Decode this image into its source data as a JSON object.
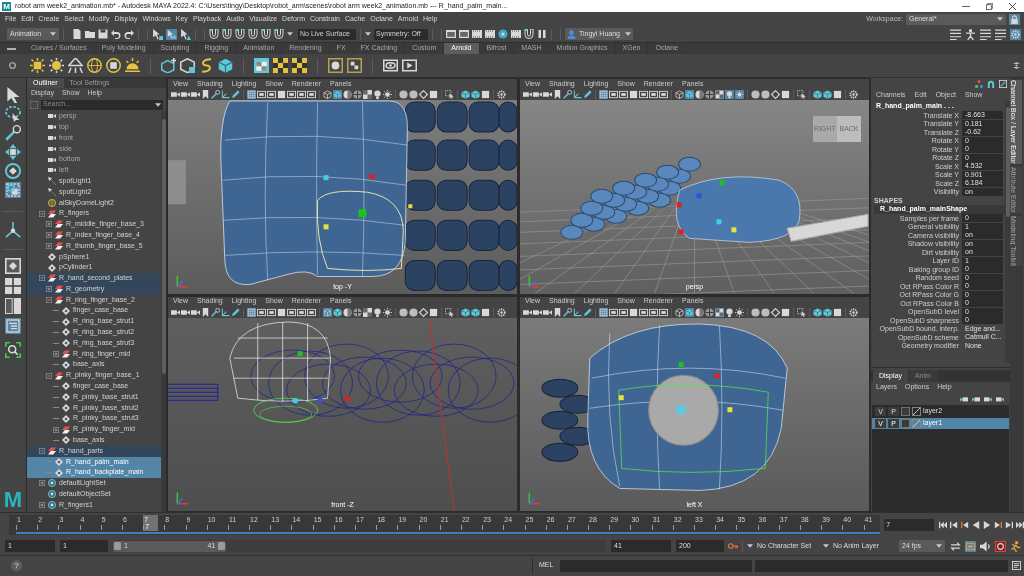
{
  "window": {
    "logo": "M",
    "title": "robot arm week2_animation.mb* - Autodesk MAYA 2022.4: C:\\Users\\tingy\\Desktop\\robot_arm\\scenes\\robot arm week2_animation.mb --- R_hand_palm_main..."
  },
  "menu_bar": [
    "File",
    "Edit",
    "Create",
    "Select",
    "Modify",
    "Display",
    "Windows",
    "Key",
    "Playback",
    "Audio",
    "Visualize",
    "Deform",
    "Constrain",
    "Cache",
    "Octane",
    "Arnold",
    "Help"
  ],
  "workspace": {
    "label": "Workspace:",
    "value": "General*",
    "locked": true
  },
  "status_line": {
    "menu_set": "Animation",
    "select_modes": [
      {
        "selected": false
      },
      {
        "selected": true
      },
      {
        "selected": false
      }
    ],
    "live_surface": "No Live Surface",
    "symmetry": "Symmetry: Off",
    "user": "Tingyi Huang",
    "panel_toggles": [
      {
        "on": false
      },
      {
        "on": false
      },
      {
        "on": false
      },
      {
        "on": false
      },
      {
        "on": true
      }
    ]
  },
  "shelf_tabs": [
    {
      "label": "Curves / Surfaces",
      "selected": false
    },
    {
      "label": "Poly Modeling",
      "selected": false
    },
    {
      "label": "Sculpting",
      "selected": false
    },
    {
      "label": "Rigging",
      "selected": false
    },
    {
      "label": "Animation",
      "selected": false
    },
    {
      "label": "Rendering",
      "selected": false
    },
    {
      "label": "FX",
      "selected": false
    },
    {
      "label": "FX Caching",
      "selected": false
    },
    {
      "label": "Custom",
      "selected": false
    },
    {
      "label": "Arnold",
      "selected": true
    },
    {
      "label": "Bifrost",
      "selected": false
    },
    {
      "label": "MASH",
      "selected": false
    },
    {
      "label": "Motion Graphics",
      "selected": false
    },
    {
      "label": "XGen",
      "selected": false
    },
    {
      "label": "Octane",
      "selected": false
    }
  ],
  "toolbox": {
    "tools": [
      {
        "selected": false
      },
      {
        "selected": false
      },
      {
        "selected": false
      },
      {
        "selected": false
      },
      {
        "selected": false
      },
      {
        "selected": true
      },
      {
        "selected": false
      }
    ],
    "layouts": [
      {
        "selected": false
      },
      {
        "selected": false
      },
      {
        "selected": false
      },
      {
        "selected": true
      }
    ],
    "logo": "M"
  },
  "outliner": {
    "tabs": [
      {
        "label": "Outliner",
        "selected": true
      },
      {
        "label": "Tool Settings",
        "selected": false
      }
    ],
    "menus": [
      "Display",
      "Show",
      "Help"
    ],
    "search": {
      "placeholder": "Search..."
    },
    "items": [
      {
        "label": "persp",
        "kind": "camera",
        "selected": false,
        "highlighted": false,
        "hidden": true
      },
      {
        "label": "top",
        "kind": "camera",
        "selected": false,
        "highlighted": false,
        "hidden": true
      },
      {
        "label": "front",
        "kind": "camera",
        "selected": false,
        "highlighted": false,
        "hidden": true
      },
      {
        "label": "side",
        "kind": "camera",
        "selected": false,
        "highlighted": false,
        "hidden": true
      },
      {
        "label": "bottom",
        "kind": "camera",
        "selected": false,
        "highlighted": false,
        "hidden": true
      },
      {
        "label": "left",
        "kind": "camera",
        "selected": false,
        "highlighted": false,
        "hidden": true
      },
      {
        "label": "spotLight1",
        "kind": "spotlight",
        "selected": false,
        "highlighted": false,
        "hidden": false
      },
      {
        "label": "spotLight2",
        "kind": "spotlight",
        "selected": false,
        "highlighted": false,
        "hidden": false
      },
      {
        "label": "aiSkyDomeLight2",
        "kind": "skydome",
        "selected": false,
        "highlighted": false,
        "hidden": false
      },
      {
        "label": "R_fingers",
        "kind": "group",
        "expanded": true,
        "selected": false,
        "highlighted": false,
        "hidden": false,
        "children": [
          {
            "label": "R_middle_finger_base_3",
            "kind": "group",
            "expanded": false,
            "selected": false,
            "highlighted": false,
            "hidden": false
          },
          {
            "label": "R_index_finger_base_4",
            "kind": "group",
            "expanded": false,
            "selected": false,
            "highlighted": false,
            "hidden": false
          },
          {
            "label": "R_thumb_finger_base_5",
            "kind": "group",
            "expanded": false,
            "selected": false,
            "highlighted": false,
            "hidden": false
          }
        ]
      },
      {
        "label": "pSphere1",
        "kind": "transform",
        "selected": false,
        "highlighted": false,
        "hidden": false
      },
      {
        "label": "pCylinder1",
        "kind": "transform",
        "selected": false,
        "highlighted": false,
        "hidden": false
      },
      {
        "label": "R_hand_second_plates",
        "kind": "group",
        "expanded": true,
        "selected": false,
        "highlighted": true,
        "hidden": false,
        "children": [
          {
            "label": "R_geometry",
            "kind": "group",
            "expanded": false,
            "selected": false,
            "highlighted": true,
            "hidden": false
          },
          {
            "label": "R_ring_finger_base_2",
            "kind": "group",
            "expanded": true,
            "selected": false,
            "highlighted": false,
            "hidden": false,
            "children": [
              {
                "label": "finger_case_base",
                "kind": "transform",
                "selected": false,
                "highlighted": false,
                "hidden": false
              },
              {
                "label": "R_ring_base_strut1",
                "kind": "transform",
                "selected": false,
                "highlighted": false,
                "hidden": false
              },
              {
                "label": "R_ring_base_strut2",
                "kind": "transform",
                "selected": false,
                "highlighted": false,
                "hidden": false
              },
              {
                "label": "R_ring_base_strut3",
                "kind": "transform",
                "selected": false,
                "highlighted": false,
                "hidden": false
              },
              {
                "label": "R_ring_finger_mid",
                "kind": "group",
                "expanded": false,
                "selected": false,
                "highlighted": false,
                "hidden": false
              },
              {
                "label": "base_axis",
                "kind": "transform",
                "selected": false,
                "highlighted": false,
                "hidden": false
              }
            ]
          },
          {
            "label": "R_pinky_finger_base_1",
            "kind": "group",
            "expanded": true,
            "selected": false,
            "highlighted": false,
            "hidden": false,
            "children": [
              {
                "label": "finger_case_base",
                "kind": "transform",
                "selected": false,
                "highlighted": false,
                "hidden": false
              },
              {
                "label": "R_pinky_base_strut1",
                "kind": "transform",
                "selected": false,
                "highlighted": false,
                "hidden": false
              },
              {
                "label": "R_pinky_base_strut2",
                "kind": "transform",
                "selected": false,
                "highlighted": false,
                "hidden": false
              },
              {
                "label": "R_pinky_base_strut3",
                "kind": "transform",
                "selected": false,
                "highlighted": false,
                "hidden": false
              },
              {
                "label": "R_pinky_finger_mid",
                "kind": "group",
                "expanded": false,
                "selected": false,
                "highlighted": false,
                "hidden": false
              },
              {
                "label": "base_axis",
                "kind": "transform",
                "selected": false,
                "highlighted": false,
                "hidden": false
              }
            ]
          }
        ]
      },
      {
        "label": "R_hand_parts",
        "kind": "group",
        "expanded": true,
        "selected": false,
        "highlighted": true,
        "hidden": false,
        "children": [
          {
            "label": "R_hand_palm_main",
            "kind": "transform",
            "selected": true,
            "highlighted": false,
            "hidden": false
          },
          {
            "label": "R_hand_backplate_main",
            "kind": "transform",
            "selected": true,
            "highlighted": false,
            "hidden": false
          }
        ]
      },
      {
        "label": "defaultLightSet",
        "kind": "set",
        "expanded": false,
        "selected": false,
        "highlighted": false,
        "hidden": false
      },
      {
        "label": "defaultObjectSet",
        "kind": "set",
        "selected": false,
        "highlighted": false,
        "hidden": false
      },
      {
        "label": "R_fingers1",
        "kind": "set",
        "expanded": false,
        "selected": false,
        "highlighted": false,
        "hidden": false
      }
    ]
  },
  "viewports": [
    {
      "menus": [
        "View",
        "Shading",
        "Lighting",
        "Show",
        "Renderer",
        "Panels"
      ],
      "toolbar": [
        {
          "on": false
        },
        {
          "on": false
        },
        {
          "on": false
        },
        {
          "on": false
        },
        {
          "on": false
        },
        {
          "on": false
        },
        {
          "on": false
        },
        {
          "on": true
        },
        {
          "on": false
        },
        {
          "on": false
        },
        {
          "on": false
        },
        {
          "on": false
        },
        {
          "on": false
        },
        {
          "on": false
        },
        {
          "on": false
        },
        {
          "on": true
        },
        {
          "on": false
        },
        {
          "on": false
        },
        {
          "on": false
        },
        {
          "on": false
        },
        {
          "on": false
        },
        {
          "on": false
        },
        {
          "on": false
        },
        {
          "on": false
        },
        {
          "on": false
        },
        {
          "on": false
        },
        {
          "on": false
        },
        {
          "on": false
        },
        {
          "on": false
        },
        {
          "on": false
        }
      ],
      "camera": "top -Y"
    },
    {
      "menus": [
        "View",
        "Shading",
        "Lighting",
        "Show",
        "Renderer",
        "Panels"
      ],
      "toolbar": [
        {
          "on": false
        },
        {
          "on": false
        },
        {
          "on": false
        },
        {
          "on": false
        },
        {
          "on": false
        },
        {
          "on": false
        },
        {
          "on": false
        },
        {
          "on": true
        },
        {
          "on": false
        },
        {
          "on": false
        },
        {
          "on": false
        },
        {
          "on": false
        },
        {
          "on": false
        },
        {
          "on": false
        },
        {
          "on": false
        },
        {
          "on": true
        },
        {
          "on": false
        },
        {
          "on": false
        },
        {
          "on": true
        },
        {
          "on": true
        },
        {
          "on": true
        },
        {
          "on": false
        },
        {
          "on": false
        },
        {
          "on": false
        },
        {
          "on": false
        },
        {
          "on": false
        },
        {
          "on": false
        },
        {
          "on": false
        },
        {
          "on": false
        },
        {
          "on": false
        }
      ],
      "view_cube": [
        "RIGHT",
        "BACK"
      ],
      "camera": "persp"
    },
    {
      "menus": [
        "View",
        "Shading",
        "Lighting",
        "Show",
        "Renderer",
        "Panels"
      ],
      "toolbar": [
        {
          "on": false
        },
        {
          "on": false
        },
        {
          "on": false
        },
        {
          "on": false
        },
        {
          "on": false
        },
        {
          "on": false
        },
        {
          "on": false
        },
        {
          "on": true
        },
        {
          "on": false
        },
        {
          "on": false
        },
        {
          "on": false
        },
        {
          "on": false
        },
        {
          "on": false
        },
        {
          "on": false
        },
        {
          "on": true
        },
        {
          "on": false
        },
        {
          "on": false
        },
        {
          "on": false
        },
        {
          "on": false
        },
        {
          "on": false
        },
        {
          "on": false
        },
        {
          "on": false
        },
        {
          "on": false
        },
        {
          "on": false
        },
        {
          "on": false
        },
        {
          "on": false
        },
        {
          "on": false
        },
        {
          "on": false
        },
        {
          "on": false
        },
        {
          "on": false
        }
      ],
      "camera": "front -Z"
    },
    {
      "menus": [
        "View",
        "Shading",
        "Lighting",
        "Show",
        "Renderer",
        "Panels"
      ],
      "toolbar": [
        {
          "on": false
        },
        {
          "on": false
        },
        {
          "on": false
        },
        {
          "on": false
        },
        {
          "on": false
        },
        {
          "on": false
        },
        {
          "on": false
        },
        {
          "on": true
        },
        {
          "on": false
        },
        {
          "on": false
        },
        {
          "on": false
        },
        {
          "on": false
        },
        {
          "on": false
        },
        {
          "on": false
        },
        {
          "on": false
        },
        {
          "on": true
        },
        {
          "on": false
        },
        {
          "on": false
        },
        {
          "on": true
        },
        {
          "on": false
        },
        {
          "on": false
        },
        {
          "on": false
        },
        {
          "on": false
        },
        {
          "on": false
        },
        {
          "on": false
        },
        {
          "on": false
        },
        {
          "on": false
        },
        {
          "on": false
        },
        {
          "on": false
        },
        {
          "on": false
        }
      ],
      "camera": "left X"
    }
  ],
  "channel_box": {
    "menus": [
      "Channels",
      "Edit",
      "Object",
      "Show"
    ],
    "object": "R_hand_palm_main . . .",
    "channels": [
      {
        "name": "Translate X",
        "value": "-8.663"
      },
      {
        "name": "Translate Y",
        "value": "0.181"
      },
      {
        "name": "Translate Z",
        "value": "-0.62"
      },
      {
        "name": "Rotate X",
        "value": "0"
      },
      {
        "name": "Rotate Y",
        "value": "0"
      },
      {
        "name": "Rotate Z",
        "value": "0"
      },
      {
        "name": "Scale X",
        "value": "4.532"
      },
      {
        "name": "Scale Y",
        "value": "0.901"
      },
      {
        "name": "Scale Z",
        "value": "6.184"
      },
      {
        "name": "Visibility",
        "value": "on"
      }
    ],
    "section": "SHAPES",
    "shape": "R_hand_palm_mainShape",
    "shape_channels": [
      {
        "kind": "field",
        "name": "Samples per frame",
        "value": "0"
      },
      {
        "kind": "field",
        "name": "General visibility",
        "value": "1"
      },
      {
        "kind": "field",
        "name": "Camera visibility",
        "value": "on"
      },
      {
        "kind": "field",
        "name": "Shadow visibility",
        "value": "on"
      },
      {
        "kind": "field",
        "name": "Dirt visibility",
        "value": "on"
      },
      {
        "kind": "field",
        "name": "Layer ID",
        "value": "1"
      },
      {
        "kind": "field",
        "name": "Baking group ID",
        "value": "0"
      },
      {
        "kind": "field",
        "name": "Random seed",
        "value": "0"
      },
      {
        "kind": "field",
        "name": "Oct RPass Color R",
        "value": "0"
      },
      {
        "kind": "field",
        "name": "Oct RPass Color G",
        "value": "0"
      },
      {
        "kind": "field",
        "name": "Oct RPass Color B",
        "value": "0"
      },
      {
        "kind": "field",
        "name": "OpenSubD level",
        "value": "0"
      },
      {
        "kind": "field",
        "name": "OpenSubD sharpness",
        "value": "0"
      },
      {
        "kind": "menu",
        "name": "OpenSubD bound. interp.",
        "value": "Edge and..."
      },
      {
        "kind": "menu",
        "name": "OpenSubD scheme",
        "value": "Catmull C..."
      },
      {
        "kind": "menu",
        "name": "Geometry modifier",
        "value": "None"
      }
    ]
  },
  "side_tabs": [
    {
      "label": "Channel Box / Layer Editor",
      "selected": true
    },
    {
      "label": "Attribute Editor",
      "selected": false
    },
    {
      "label": "Modeling Toolkit",
      "selected": false
    }
  ],
  "layer_editor": {
    "tabs": [
      {
        "label": "Display",
        "selected": true
      },
      {
        "label": "Anim",
        "selected": false
      }
    ],
    "menus": [
      "Layers",
      "Options",
      "Help"
    ],
    "layers": [
      {
        "visibility": "V",
        "playback": "P",
        "name": "layer2",
        "selected": false
      },
      {
        "visibility": "V",
        "playback": "P",
        "name": "layer1",
        "selected": true
      }
    ]
  },
  "time_slider": {
    "ticks": [
      {
        "label": "1",
        "current": false
      },
      {
        "label": "2",
        "current": false
      },
      {
        "label": "3",
        "current": false
      },
      {
        "label": "4",
        "current": false
      },
      {
        "label": "5",
        "current": false
      },
      {
        "label": "6",
        "current": false
      },
      {
        "label": "7",
        "current": true
      },
      {
        "label": "8",
        "current": false
      },
      {
        "label": "9",
        "current": false
      },
      {
        "label": "10",
        "current": false
      },
      {
        "label": "11",
        "current": false
      },
      {
        "label": "12",
        "current": false
      },
      {
        "label": "13",
        "current": false
      },
      {
        "label": "14",
        "current": false
      },
      {
        "label": "15",
        "current": false
      },
      {
        "label": "16",
        "current": false
      },
      {
        "label": "17",
        "current": false
      },
      {
        "label": "18",
        "current": false
      },
      {
        "label": "19",
        "current": false
      },
      {
        "label": "20",
        "current": false
      },
      {
        "label": "21",
        "current": false
      },
      {
        "label": "22",
        "current": false
      },
      {
        "label": "23",
        "current": false
      },
      {
        "label": "24",
        "current": false
      },
      {
        "label": "25",
        "current": false
      },
      {
        "label": "26",
        "current": false
      },
      {
        "label": "27",
        "current": false
      },
      {
        "label": "28",
        "current": false
      },
      {
        "label": "29",
        "current": false
      },
      {
        "label": "30",
        "current": false
      },
      {
        "label": "31",
        "current": false
      },
      {
        "label": "32",
        "current": false
      },
      {
        "label": "33",
        "current": false
      },
      {
        "label": "34",
        "current": false
      },
      {
        "label": "35",
        "current": false
      },
      {
        "label": "36",
        "current": false
      },
      {
        "label": "37",
        "current": false
      },
      {
        "label": "38",
        "current": false
      },
      {
        "label": "39",
        "current": false
      },
      {
        "label": "40",
        "current": false
      },
      {
        "label": "41",
        "current": false
      }
    ],
    "current_frame": "7",
    "cache": {
      "level": 1
    },
    "current_frame_field": "7"
  },
  "range_slider": {
    "start": "1",
    "playback_start": "1",
    "level": 0.23,
    "range_start": "1",
    "range_end": "41",
    "playback_end": "41",
    "end": "200",
    "character_set": "No Character Set",
    "anim_layer": "No Anim Layer",
    "fps": "24 fps",
    "toggles": [
      {
        "on": false
      },
      {
        "on": true
      },
      {
        "on": false
      }
    ],
    "auto_key": true
  },
  "command_line": {
    "help": "?",
    "language": "MEL"
  }
}
